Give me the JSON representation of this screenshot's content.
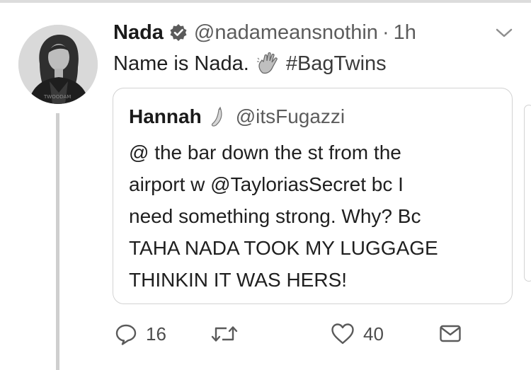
{
  "tweet": {
    "author_name": "Nada",
    "handle": "@nadameansnothin",
    "separator": "·",
    "time": "1h",
    "text": "Name is Nada.",
    "emoji": "waving-hand-emoji",
    "hashtag": "#BagTwins",
    "avatar_shirt_text": "TWOODAM"
  },
  "quoted_tweet": {
    "author_name": "Hannah",
    "emoji": "banana-emoji",
    "handle": "@itsFugazzi",
    "lines": [
      "@ the bar down the st from the",
      "airport w @TayloriasSecret bc I",
      "need something strong. Why? Bc",
      "TAHA NADA TOOK MY LUGGAGE",
      "THINKIN IT WAS HERS!"
    ]
  },
  "actions": {
    "reply_count": "16",
    "retweet_count": "",
    "like_count": "40",
    "reply_icon": "reply-icon",
    "retweet_icon": "retweet-icon",
    "like_icon": "heart-icon",
    "dm_icon": "envelope-icon"
  },
  "colors": {
    "text": "#1f1f1f",
    "muted": "#5c5c5c",
    "border": "#d3d3d3",
    "icon": "#5a5a5a"
  }
}
